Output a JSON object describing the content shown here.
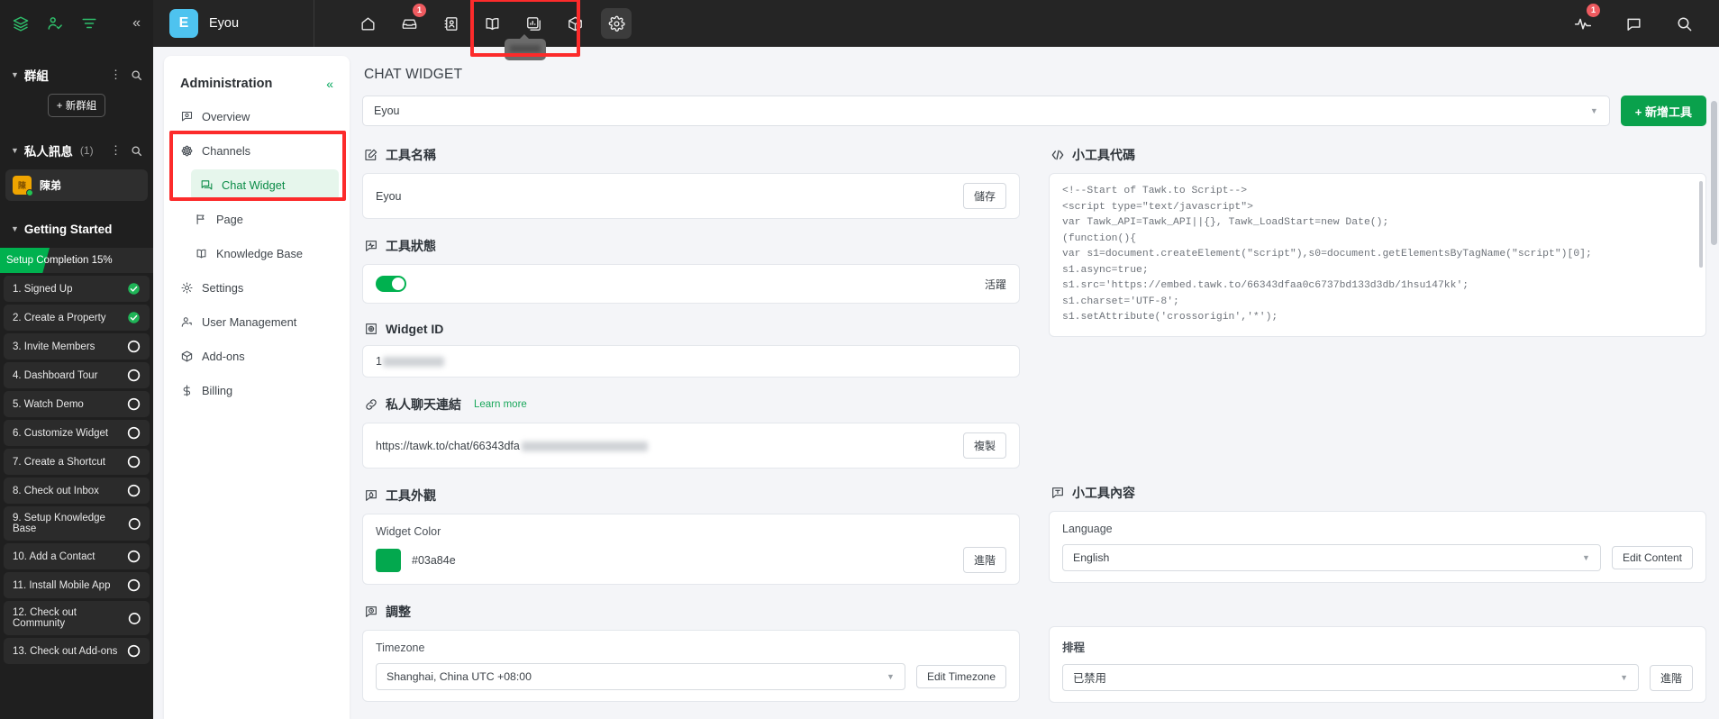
{
  "rail": {
    "top_icons": [
      "layers-icon",
      "user-check-icon",
      "filter-icon"
    ],
    "collapse_label": "«",
    "sections": [
      {
        "title": "群組",
        "count": "",
        "new_button": "+ 新群組"
      },
      {
        "title": "私人訊息",
        "count": "(1)"
      }
    ],
    "dm": {
      "initials": "陳",
      "name": "陳弟"
    },
    "getting_started": {
      "title": "Getting Started",
      "progress_label": "Setup Completion 15%",
      "progress_percent": 15,
      "tasks": [
        {
          "label": "1. Signed Up",
          "done": true
        },
        {
          "label": "2. Create a Property",
          "done": true
        },
        {
          "label": "3. Invite Members",
          "done": false
        },
        {
          "label": "4. Dashboard Tour",
          "done": false
        },
        {
          "label": "5. Watch Demo",
          "done": false
        },
        {
          "label": "6. Customize Widget",
          "done": false
        },
        {
          "label": "7. Create a Shortcut",
          "done": false
        },
        {
          "label": "8. Check out Inbox",
          "done": false
        },
        {
          "label": "9. Setup Knowledge Base",
          "done": false
        },
        {
          "label": "10. Add a Contact",
          "done": false
        },
        {
          "label": "11. Install Mobile App",
          "done": false
        },
        {
          "label": "12. Check out Community",
          "done": false
        },
        {
          "label": "13. Check out Add-ons",
          "done": false
        }
      ]
    }
  },
  "topbar": {
    "brand_initial": "E",
    "brand_name": "Eyou",
    "nav_icons": [
      {
        "name": "home-icon",
        "badge": ""
      },
      {
        "name": "inbox-icon",
        "badge": "1"
      },
      {
        "name": "contacts-icon",
        "badge": ""
      },
      {
        "name": "knowledge-book-icon",
        "badge": ""
      },
      {
        "name": "reports-icon",
        "badge": ""
      },
      {
        "name": "addons-box-icon",
        "badge": ""
      },
      {
        "name": "gear-icon",
        "badge": ""
      }
    ],
    "right_icons": [
      {
        "name": "monitoring-pulse-icon",
        "badge": "1"
      },
      {
        "name": "chat-bubble-icon",
        "badge": ""
      },
      {
        "name": "search-icon",
        "badge": ""
      }
    ]
  },
  "admin_nav": {
    "title": "Administration",
    "collapse": "«",
    "items": [
      {
        "label": "Overview",
        "icon": "overview-icon",
        "level": 0,
        "selected": false
      },
      {
        "label": "Channels",
        "icon": "channels-icon",
        "level": 0,
        "selected": false
      },
      {
        "label": "Chat Widget",
        "icon": "chat-widget-icon",
        "level": 1,
        "selected": true
      },
      {
        "label": "Page",
        "icon": "page-flag-icon",
        "level": 1,
        "selected": false
      },
      {
        "label": "Knowledge Base",
        "icon": "book-icon",
        "level": 1,
        "selected": false
      },
      {
        "label": "Settings",
        "icon": "gear-icon",
        "level": 0,
        "selected": false
      },
      {
        "label": "User Management",
        "icon": "user-icon",
        "level": 0,
        "selected": false
      },
      {
        "label": "Add-ons",
        "icon": "box-icon",
        "level": 0,
        "selected": false
      },
      {
        "label": "Billing",
        "icon": "dollar-icon",
        "level": 0,
        "selected": false
      }
    ]
  },
  "main": {
    "page_title": "CHAT WIDGET",
    "widget_selector_value": "Eyou",
    "add_widget_button": "+ 新增工具",
    "widget_name": {
      "section_title": "工具名稱",
      "value": "Eyou",
      "save_button": "儲存"
    },
    "widget_status": {
      "section_title": "工具狀態",
      "status_text": "活躍",
      "enabled": true
    },
    "widget_id": {
      "section_title": "Widget ID",
      "value_prefix": "1"
    },
    "private_chat_link": {
      "section_title": "私人聊天連結",
      "learn_more": "Learn more",
      "value_prefix": "https://tawk.to/chat/66343dfa",
      "copy_button": "複製"
    },
    "widget_appearance": {
      "section_title": "工具外觀",
      "color_label": "Widget Color",
      "color_hex": "#03a84e",
      "advanced_button": "進階"
    },
    "adjust": {
      "section_title": "調整",
      "timezone_label": "Timezone",
      "timezone_value": "Shanghai, China UTC +08:00",
      "edit_timezone_button": "Edit Timezone"
    },
    "widget_code": {
      "section_title": "小工具代碼",
      "code": "<!--Start of Tawk.to Script-->\n<script type=\"text/javascript\">\nvar Tawk_API=Tawk_API||{}, Tawk_LoadStart=new Date();\n(function(){\nvar s1=document.createElement(\"script\"),s0=document.getElementsByTagName(\"script\")[0];\ns1.async=true;\ns1.src='https://embed.tawk.to/66343dfaa0c6737bd133d3db/1hsu147kk';\ns1.charset='UTF-8';\ns1.setAttribute('crossorigin','*');"
    },
    "widget_content": {
      "section_title": "小工具內容",
      "language_label": "Language",
      "language_value": "English",
      "edit_content_button": "Edit Content"
    },
    "schedule": {
      "label": "排程",
      "value": "已禁用",
      "advanced_button": "進階"
    }
  },
  "colors": {
    "accent_green": "#0aa14c",
    "widget_color": "#03a84e",
    "brand_blue": "#4ec3ef",
    "badge_red": "#ef5b60",
    "highlight_red": "#fc2b2b"
  }
}
